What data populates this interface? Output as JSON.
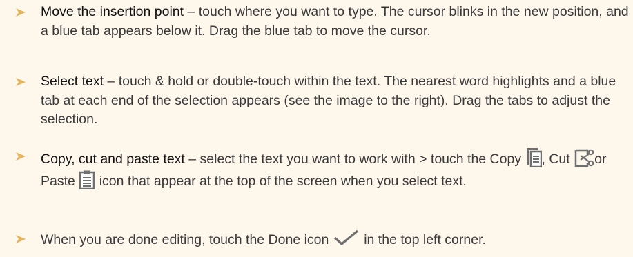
{
  "bullets": [
    {
      "term": "Move the insertion point",
      "text": " – touch where you want to type. The cursor blinks in the new position, and a blue tab appears below it. Drag the blue tab to move the cursor."
    },
    {
      "term": "Select text",
      "text": " – touch & hold or double-touch within the text. The nearest word highlights and a blue tab at each end of the selection appears (see the image to the right). Drag the tabs to adjust the selection."
    },
    {
      "term": "Copy, cut and paste text",
      "text_a": " – select the text you want to work with > touch the Copy ",
      "text_b": ", Cut ",
      "text_c": "or Paste ",
      "text_d": "icon that appear at the top of the screen when you select text.",
      "icons": [
        "copy-icon",
        "cut-icon",
        "paste-icon"
      ]
    },
    {
      "text_a": "When you are done editing, touch the Done icon ",
      "text_b": " in the top left corner.",
      "icons": [
        "done-checkmark-icon"
      ]
    }
  ],
  "colors": {
    "background": "#fdf7ec",
    "bullet": "#e3b35d",
    "icon_gray": "#6f6f6f",
    "text": "#3a3a3a"
  }
}
